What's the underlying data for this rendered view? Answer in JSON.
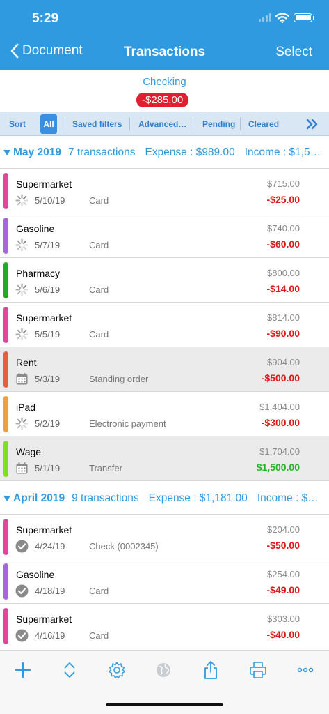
{
  "status": {
    "time": "5:29"
  },
  "nav": {
    "back_label": "Document",
    "title": "Transactions",
    "select_label": "Select"
  },
  "account": {
    "name": "Checking",
    "balance": "-$285.00"
  },
  "filters": {
    "sort": "Sort",
    "all": "All",
    "saved": "Saved filters",
    "advanced": "Advanced…",
    "pending": "Pending",
    "cleared": "Cleared"
  },
  "groups": [
    {
      "month": "May 2019",
      "count": "7 transactions",
      "expense": "Expense : $989.00",
      "income": "Income : $1,5…",
      "rows": [
        {
          "payee": "Supermarket",
          "date": "5/10/19",
          "method": "Card",
          "balance": "$715.00",
          "amount": "-$25.00",
          "sign": "neg",
          "color": "#e0489a",
          "status_icon": "pending-icon",
          "highlight": false
        },
        {
          "payee": "Gasoline",
          "date": "5/7/19",
          "method": "Card",
          "balance": "$740.00",
          "amount": "-$60.00",
          "sign": "neg",
          "color": "#a666e0",
          "status_icon": "pending-icon",
          "highlight": false
        },
        {
          "payee": "Pharmacy",
          "date": "5/6/19",
          "method": "Card",
          "balance": "$800.00",
          "amount": "-$14.00",
          "sign": "neg",
          "color": "#22aa22",
          "status_icon": "pending-icon",
          "highlight": false
        },
        {
          "payee": "Supermarket",
          "date": "5/5/19",
          "method": "Card",
          "balance": "$814.00",
          "amount": "-$90.00",
          "sign": "neg",
          "color": "#e0489a",
          "status_icon": "pending-icon",
          "highlight": false
        },
        {
          "payee": "Rent",
          "date": "5/3/19",
          "method": "Standing order",
          "balance": "$904.00",
          "amount": "-$500.00",
          "sign": "neg",
          "color": "#e8603a",
          "status_icon": "calendar-icon",
          "highlight": true
        },
        {
          "payee": "iPad",
          "date": "5/2/19",
          "method": "Electronic payment",
          "balance": "$1,404.00",
          "amount": "-$300.00",
          "sign": "neg",
          "color": "#f0a040",
          "status_icon": "pending-icon",
          "highlight": false
        },
        {
          "payee": "Wage",
          "date": "5/1/19",
          "method": "Transfer",
          "balance": "$1,704.00",
          "amount": "$1,500.00",
          "sign": "pos",
          "color": "#7ee020",
          "status_icon": "calendar-icon",
          "highlight": true
        }
      ]
    },
    {
      "month": "April 2019",
      "count": "9 transactions",
      "expense": "Expense : $1,181.00",
      "income": "Income : $…",
      "rows": [
        {
          "payee": "Supermarket",
          "date": "4/24/19",
          "method": "Check (0002345)",
          "balance": "$204.00",
          "amount": "-$50.00",
          "sign": "neg",
          "color": "#e0489a",
          "status_icon": "check-circle-icon",
          "highlight": false
        },
        {
          "payee": "Gasoline",
          "date": "4/18/19",
          "method": "Card",
          "balance": "$254.00",
          "amount": "-$49.00",
          "sign": "neg",
          "color": "#a666e0",
          "status_icon": "check-circle-icon",
          "highlight": false
        },
        {
          "payee": "Supermarket",
          "date": "4/16/19",
          "method": "Card",
          "balance": "$303.00",
          "amount": "-$40.00",
          "sign": "neg",
          "color": "#e0489a",
          "status_icon": "check-circle-icon",
          "highlight": false
        }
      ]
    }
  ],
  "toolbar_icons": [
    "plus-icon",
    "sort-arrows-icon",
    "gear-icon",
    "globe-icon",
    "share-icon",
    "print-icon",
    "more-icon"
  ],
  "colors": {
    "accent": "#2f9ae0",
    "negative": "#e01818",
    "positive": "#1fb81f",
    "badge": "#e02030"
  }
}
